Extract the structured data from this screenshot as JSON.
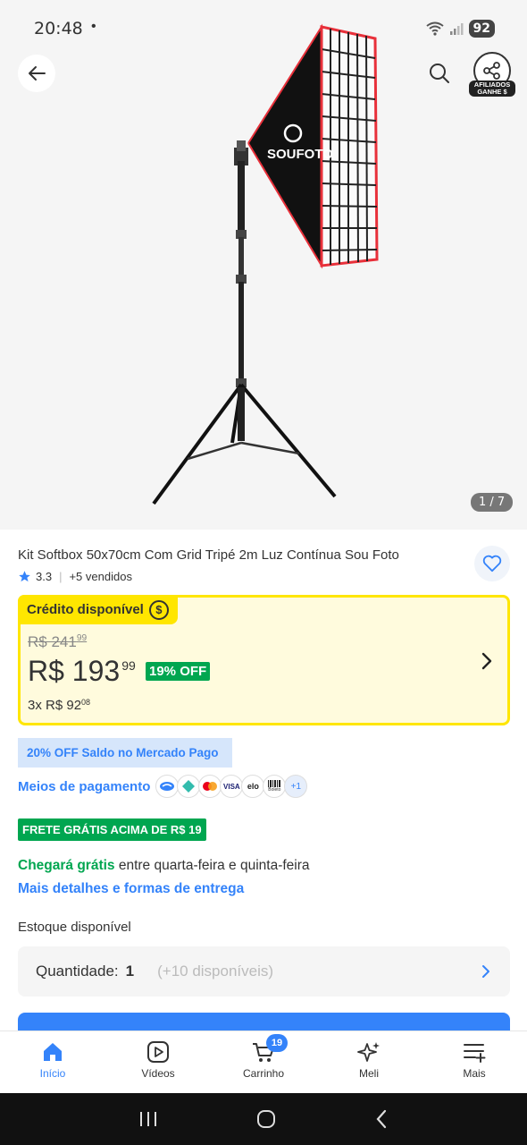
{
  "status_bar": {
    "time": "20:48",
    "dot": "•",
    "battery": "92"
  },
  "header": {
    "affiliates_label": "AFILIADOS GANHE $"
  },
  "gallery": {
    "counter": "1 / 7",
    "brand_text": "SOUFOTO"
  },
  "product": {
    "title": "Kit Softbox 50x70cm Com Grid Tripé 2m Luz Contínua Sou Foto",
    "rating": "3.3",
    "sold": "+5 vendidos"
  },
  "credit": {
    "label": "Crédito disponível",
    "coin": "$",
    "old_price": "R$ 241",
    "old_cents": "99",
    "price": "R$ 193",
    "price_cents": "99",
    "discount": "19% OFF",
    "installments": "3x R$ 92",
    "installment_cents": "08"
  },
  "saldo_banner": "20% OFF Saldo no Mercado Pago",
  "payments": {
    "label": "Meios de pagamento",
    "visa": "VISA",
    "elo": "elo",
    "boleto": "Boleto",
    "more": "+1"
  },
  "shipping": {
    "badge": "FRETE GRÁTIS ACIMA DE R$ 19",
    "arrival_green": "Chegará grátis",
    "arrival_rest": " entre quarta-feira e quinta-feira",
    "details_link": "Mais detalhes e formas de entrega"
  },
  "stock": {
    "label": "Estoque disponível",
    "qty_label": "Quantidade:",
    "qty_value": "1",
    "available": "(+10 disponíveis)"
  },
  "bottom_nav": {
    "home": "Início",
    "videos": "Vídeos",
    "cart": "Carrinho",
    "cart_count": "19",
    "meli": "Meli",
    "more": "Mais"
  },
  "colors": {
    "accent": "#3483fa",
    "green": "#00a650",
    "yellow": "#ffe600",
    "softbox_red": "#e8303a"
  }
}
